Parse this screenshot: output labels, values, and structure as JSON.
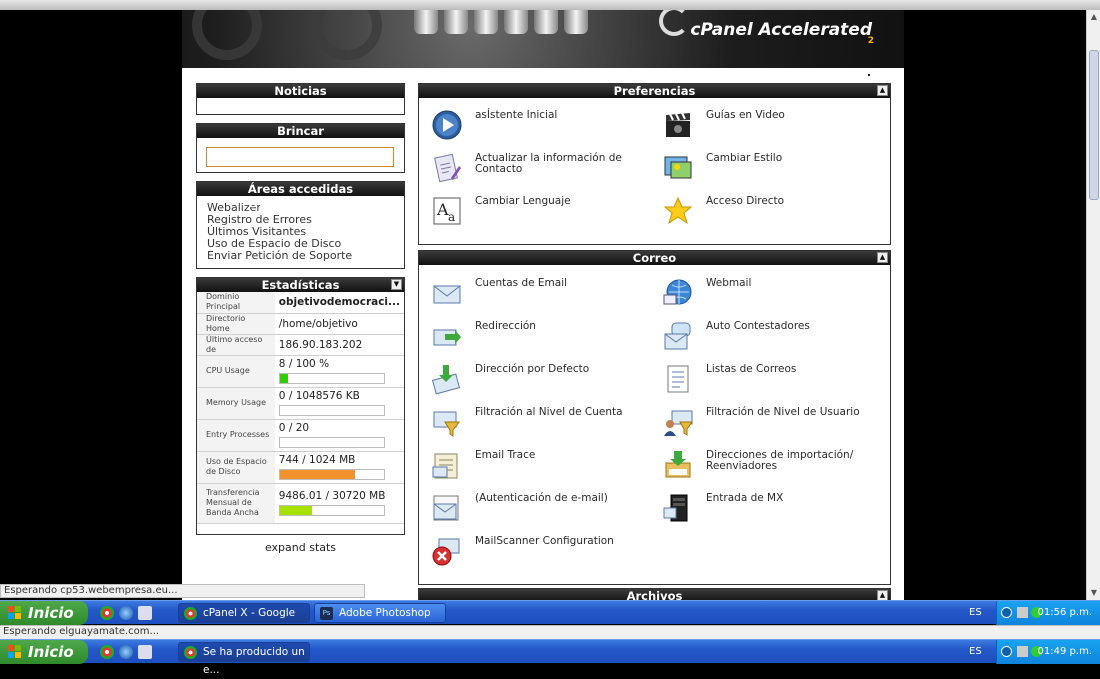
{
  "browser": {
    "tabs": [
      "",
      "",
      "",
      ""
    ]
  },
  "header": {
    "logo": "cPanel Accelerated",
    "logo_sub": "2"
  },
  "sidebar": {
    "noticias_title": "Noticias",
    "brincar_title": "Brincar",
    "brincar_value": "",
    "areas_title": "Áreas accedidas frecuentemente",
    "areas_links": [
      "Webalizer",
      "Registro de Errores",
      "Últimos Visitantes",
      "Uso de Espacio de Disco",
      "Enviar Petición de Soporte"
    ],
    "stats_title": "Estadísticas",
    "expand_label": "expand stats"
  },
  "stats": [
    {
      "label": "Dominio Principal",
      "value": "objetivodemocraci..."
    },
    {
      "label": "Directorio Home",
      "value": "/home/objetivo"
    },
    {
      "label": "Último acceso de",
      "value": "186.90.183.202"
    },
    {
      "label": "CPU Usage",
      "value": "8 / 100 %",
      "fraction": 0.08,
      "color": "#33cc00"
    },
    {
      "label": "Memory Usage",
      "value": "0 / 1048576 KB",
      "fraction": 0.0,
      "color": "#33cc00"
    },
    {
      "label": "Entry Processes",
      "value": "0 / 20",
      "fraction": 0.0,
      "color": "#33cc00"
    },
    {
      "label": "Uso de Espacio de Disco",
      "value": "744 / 1024 MB",
      "fraction": 0.727,
      "color": "#f2922e"
    },
    {
      "label": "Transferencia Mensual de Banda Ancha",
      "value": "9486.01 / 30720 MB",
      "fraction": 0.309,
      "color": "#a8e000"
    }
  ],
  "preferencias": {
    "title": "Preferencias",
    "items": [
      {
        "label": "asÍstente Inicial",
        "icon": "play-circle-icon"
      },
      {
        "label": "Guías en Video",
        "icon": "clapperboard-icon"
      },
      {
        "label": "Actualizar la información de Contacto",
        "icon": "contact-update-icon"
      },
      {
        "label": "Cambiar Estilo",
        "icon": "style-picture-icon"
      },
      {
        "label": "Cambiar Lenguaje",
        "icon": "language-icon"
      },
      {
        "label": "Acceso Directo",
        "icon": "star-icon"
      }
    ]
  },
  "correo": {
    "title": "Correo",
    "items": [
      {
        "label": "Cuentas de Email",
        "icon": "envelope-icon"
      },
      {
        "label": "Webmail",
        "icon": "globe-mail-icon"
      },
      {
        "label": "Redirección",
        "icon": "mail-forward-icon"
      },
      {
        "label": "Auto Contestadores",
        "icon": "mail-autoresponder-icon"
      },
      {
        "label": "Dirección por Defecto",
        "icon": "mail-default-icon"
      },
      {
        "label": "Listas de Correos",
        "icon": "mail-list-icon"
      },
      {
        "label": "Filtración al Nivel de Cuenta",
        "icon": "mail-filter-icon"
      },
      {
        "label": "Filtración de Nivel de Usuario",
        "icon": "user-filter-icon"
      },
      {
        "label": "Email Trace",
        "icon": "email-trace-icon"
      },
      {
        "label": "Direcciones de importación/ Reenviadores",
        "icon": "mail-import-icon"
      },
      {
        "label": "(Autenticación de e-mail)",
        "icon": "mail-auth-icon"
      },
      {
        "label": "Entrada de MX",
        "icon": "server-icon"
      },
      {
        "label": "MailScanner Configuration",
        "icon": "mailscanner-icon"
      }
    ]
  },
  "archivos": {
    "title": "Archivos"
  },
  "status": {
    "line1": "Esperando cp53.webempresa.eu...",
    "line2": "Esperando elguayamate.com..."
  },
  "taskbar1": {
    "start": "Inicio",
    "tasks": [
      "cPanel X - Google Chr...",
      "Adobe Photoshop CS..."
    ],
    "lang": "ES",
    "clock": "01:56 p.m."
  },
  "taskbar2": {
    "start": "Inicio",
    "tasks": [
      "Se ha producido un e..."
    ],
    "lang": "ES",
    "clock": "01:49 p.m."
  }
}
